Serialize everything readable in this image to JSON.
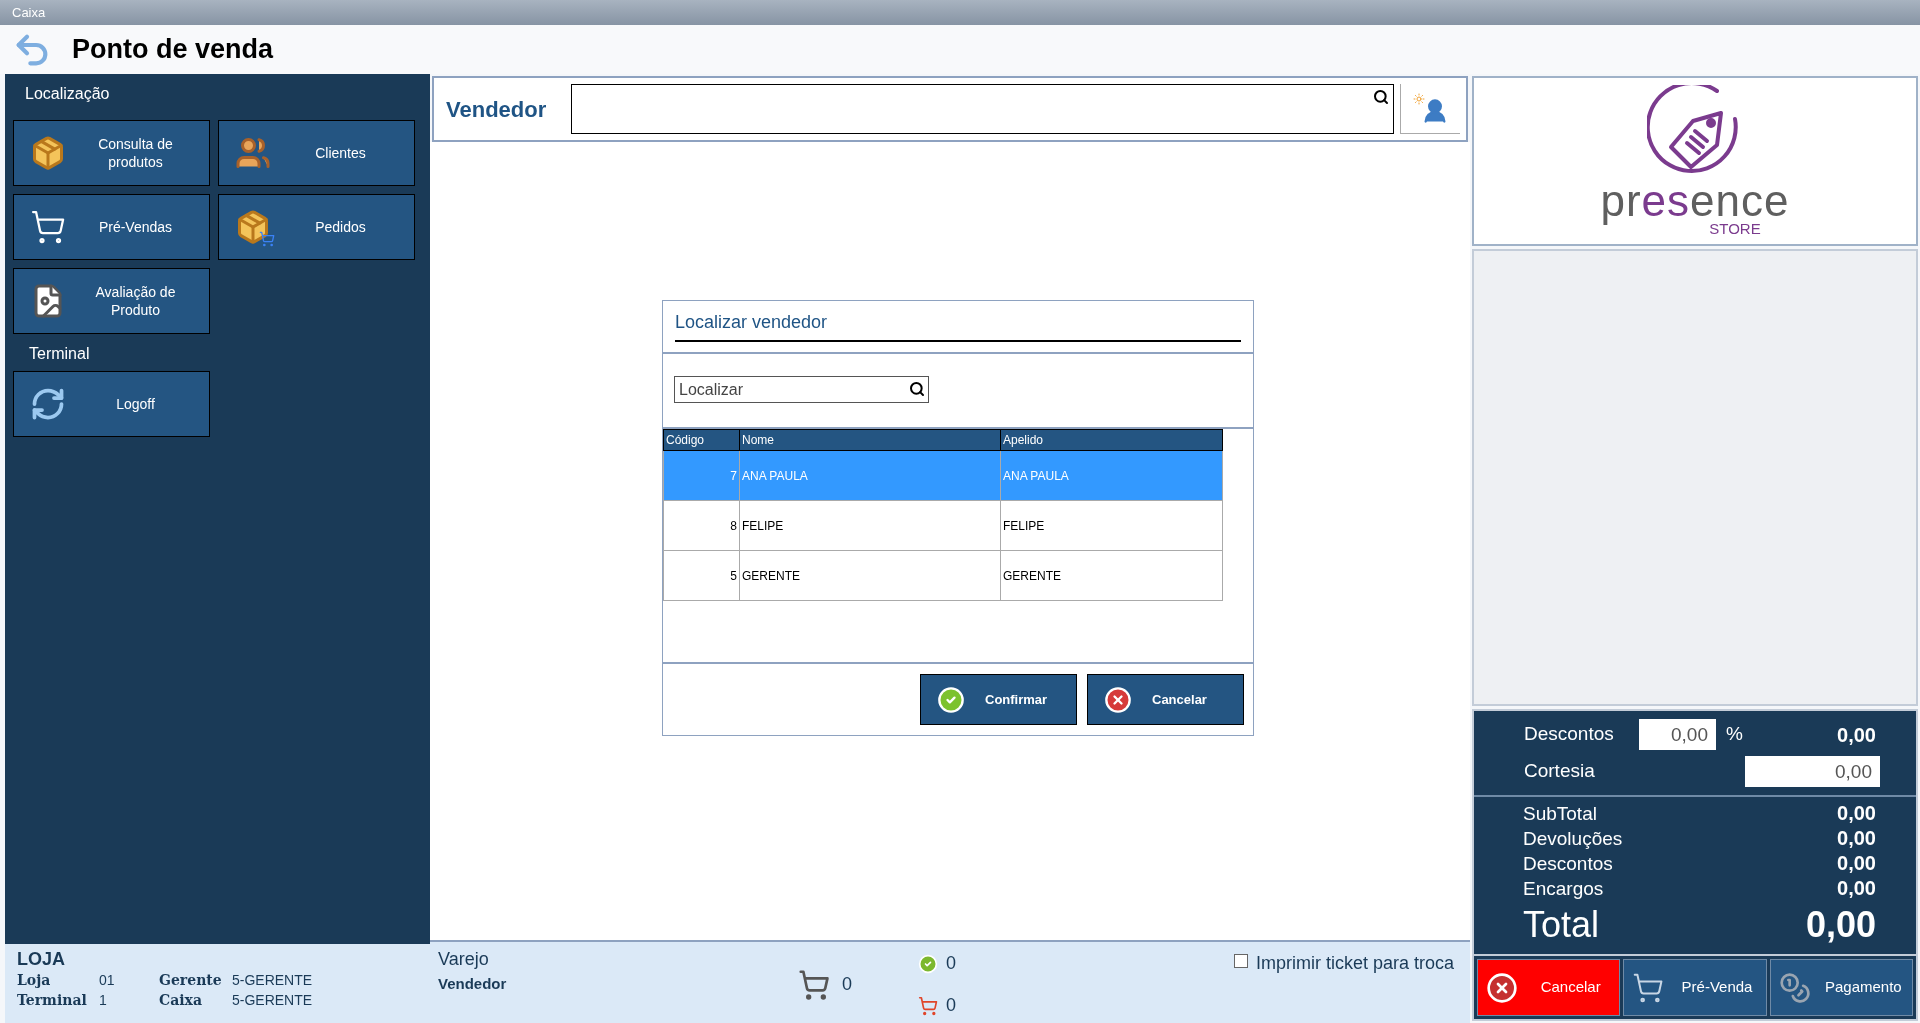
{
  "window": {
    "title": "Caixa"
  },
  "header": {
    "title": "Ponto de venda"
  },
  "sidebar": {
    "sections": [
      {
        "title": "Localização",
        "buttons": [
          {
            "label": "Consulta de produtos",
            "kind": "box"
          },
          {
            "label": "Clientes",
            "kind": "people"
          },
          {
            "label": "Pré-Vendas",
            "kind": "cart"
          },
          {
            "label": "Pedidos",
            "kind": "box-cart"
          },
          {
            "label": "Avaliação de Produto",
            "kind": "document"
          }
        ]
      },
      {
        "title": "Terminal",
        "buttons": [
          {
            "label": "Logoff",
            "kind": "refresh"
          }
        ]
      }
    ]
  },
  "vendedor": {
    "label": "Vendedor"
  },
  "dialog": {
    "title": "Localizar vendedor",
    "search": {
      "placeholder": "Localizar"
    },
    "columns": [
      "Código",
      "Nome",
      "Apelido"
    ],
    "rows": [
      {
        "cells": [
          "7",
          "ANA PAULA",
          "ANA PAULA"
        ],
        "selected": true
      },
      {
        "cells": [
          "8",
          "FELIPE",
          "FELIPE"
        ],
        "selected": false
      },
      {
        "cells": [
          "5",
          "GERENTE",
          "GERENTE"
        ],
        "selected": false
      }
    ],
    "buttons": [
      {
        "label": "Confirmar",
        "kind": "confirm"
      },
      {
        "label": "Cancelar",
        "kind": "cancel"
      }
    ]
  },
  "logo": {
    "parts": [
      {
        "text": "pr",
        "color": "#5f5f5f"
      },
      {
        "text": "es",
        "color": "#7b3b8e"
      },
      {
        "text": "ence",
        "color": "#5f5f5f"
      }
    ],
    "tagline": "STORE"
  },
  "summary": {
    "descontos": {
      "label": "Descontos",
      "percent": "0,00",
      "percent_sign": "%",
      "amount": "0,00"
    },
    "cortesia": {
      "label": "Cortesia",
      "value": "0,00"
    },
    "lines": [
      {
        "label": "SubTotal",
        "value": "0,00"
      },
      {
        "label": "Devoluções",
        "value": "0,00"
      },
      {
        "label": "Descontos",
        "value": "0,00"
      },
      {
        "label": "Encargos",
        "value": "0,00"
      }
    ],
    "total": {
      "label": "Total",
      "value": "0,00"
    }
  },
  "actions": [
    {
      "label": "Cancelar",
      "kind": "cancel"
    },
    {
      "label": "Pré-Venda",
      "kind": "cart"
    },
    {
      "label": "Pagamento",
      "kind": "coins"
    }
  ],
  "status": {
    "store": {
      "title": "LOJA",
      "fields": [
        {
          "label": "Loja",
          "value": "01"
        },
        {
          "label": "Gerente",
          "value": "5-GERENTE"
        },
        {
          "label": "Terminal",
          "value": "1"
        },
        {
          "label": "Caixa",
          "value": "5-GERENTE"
        }
      ]
    },
    "sale": {
      "type": "Varejo",
      "vendedor_label": "Vendedor"
    },
    "cart_count": "0",
    "ok_count": "0",
    "cart2_count": "0",
    "print_ticket": {
      "label": "Imprimir ticket para troca",
      "checked": false
    }
  }
}
